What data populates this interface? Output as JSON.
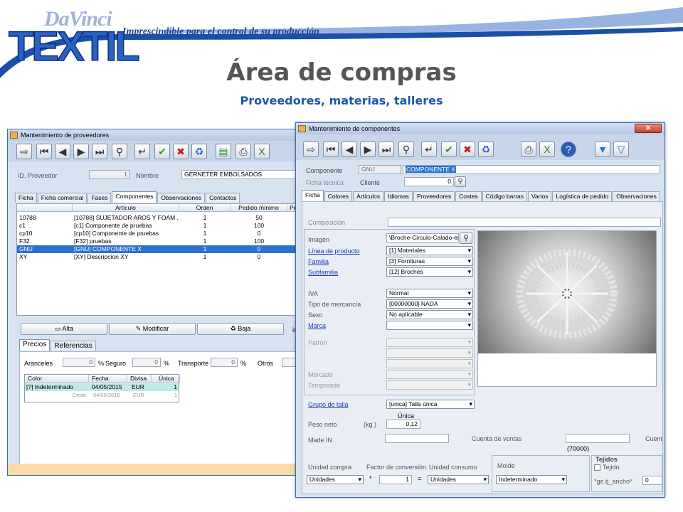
{
  "brand": {
    "small": "DaVinci",
    "big": "TEXTIL",
    "slogan": "Imprescindible para el control de su producción"
  },
  "colors": {
    "accent": "#1f55a8",
    "selection": "#2e70d0",
    "window_bg": "#d7e3f1"
  },
  "slide": {
    "title": "Área de compras",
    "subtitle": "Proveedores, materias, talleres"
  },
  "suppliers": {
    "title": "Mantenimiento de proveedores",
    "toolbar": [
      "exit-icon",
      "first-icon",
      "prev-icon",
      "next-icon",
      "last-icon",
      "search-icon",
      "enter-icon",
      "accept-icon",
      "cancel-icon",
      "recycle-icon",
      "notes-icon",
      "print-icon",
      "excel-icon"
    ],
    "id_label": "ID. Proveedor",
    "id_value": "1",
    "name_label": "Nombre",
    "name_value": "GERNETER EMBOLSADOS",
    "tabs": [
      "Ficha",
      "Ficha comercial",
      "Fases",
      "Componentes",
      "Observaciones",
      "Contactos"
    ],
    "columns": [
      "Artículo",
      "Orden",
      "Pedido mínimo",
      "Pe"
    ],
    "rows": [
      [
        "10788",
        "[10788] SUJETADOR AROS Y FOAM ...",
        "1",
        "50"
      ],
      [
        "c1",
        "[c1] Componente de pruebas",
        "1",
        "100"
      ],
      [
        "cp10",
        "[cp10] Componente de pruebas",
        "1",
        "0"
      ],
      [
        "F32",
        "[F32] pruebas",
        "1",
        "100"
      ],
      [
        "GNU",
        "[GNU] COMPONENTE X",
        "1",
        "0"
      ],
      [
        "XY",
        "[XY] Descripcion XY",
        "1",
        "0"
      ]
    ],
    "buttons": {
      "add": "Alta",
      "edit": "Modificar",
      "delete": "Baja",
      "cut": "ir"
    },
    "subtabs": [
      "Precios",
      "Referencias"
    ],
    "costs": {
      "aranceles_label": "Aranceles",
      "aranceles": "0",
      "seguro_label": "Seguro",
      "seguro": "0",
      "transporte_label": "Transporte",
      "transporte": "0",
      "otros_label": "Otros",
      "pct": "%"
    },
    "price_cols": [
      "Color",
      "Fecha",
      "Divisa",
      "Única"
    ],
    "price_rows": [
      [
        "[?]  Indeterminado",
        "04/05/2015",
        "EUR",
        "1"
      ],
      [
        "Coste",
        "04/05/2015",
        "EUR",
        "1"
      ]
    ]
  },
  "components": {
    "title": "Mantenimiento de componentes",
    "toolbar": [
      "exit-icon",
      "first-icon",
      "prev-icon",
      "next-icon",
      "last-icon",
      "search-icon",
      "enter-icon",
      "accept-icon",
      "cancel-icon",
      "recycle-icon",
      "print-icon",
      "excel-icon",
      "help-icon",
      "filter-icon",
      "clear-filter-icon"
    ],
    "component_label": "Componente",
    "component_code": "GNU",
    "component_name": "COMPONENTE X",
    "tech_label": "Ficha tecnica",
    "client_label": "Cliente",
    "client_value": "0",
    "tabs": [
      "Ficha",
      "Colores",
      "Artículos",
      "Idiomas",
      "Proveedores",
      "Costes",
      "Código barras",
      "Varios",
      "Logística de pedido",
      "Observaciones"
    ],
    "composition_label": "Composición",
    "image_label": "Imagen",
    "image_value": "\\Broche-Circulo-Calado-en-I",
    "line_label": "Línea de producto",
    "line_value": "[1] Materiales",
    "family_label": "Familia",
    "family_value": "[3] Fornituras",
    "subfamily_label": "Subfamilia",
    "subfamily_value": "[12] Broches",
    "iva_label": "IVA",
    "iva_value": "Normal",
    "goods_label": "Tipo de mercancía",
    "goods_value": "[00000000] NADA",
    "sex_label": "Sexo",
    "sex_value": "No aplicable",
    "brand_label": "Marca",
    "pattern_label": "Patrón",
    "market_label": "Mercado",
    "season_label": "Temporada",
    "size_group_label": "Grupo de talla",
    "size_group_value": "[unica] Talla única",
    "size_col": "Única",
    "weight_label": "Peso neto",
    "weight_unit": "(kg.)",
    "weight_value": "0,12",
    "made_in_label": "Made IN",
    "sales_account_label": "Cuenta de ventas",
    "sales_account_value": "(70000)",
    "cuent_label": "Cuent",
    "buy_unit_label": "Unidad compra",
    "buy_unit_value": "Unidades",
    "conv_label": "Factor de conversión",
    "conv_star": "*",
    "conv_value": "1",
    "conv_eq": "=",
    "cons_unit_label": "Unidad consumo",
    "cons_unit_value": "Unidades",
    "mold_label": "Molde",
    "mold_value": "Indeterminado",
    "woven_title": "Tejidos",
    "woven_check": "Tejido",
    "woven_field": "*ge.tj_ancho*",
    "woven_value": "0"
  }
}
